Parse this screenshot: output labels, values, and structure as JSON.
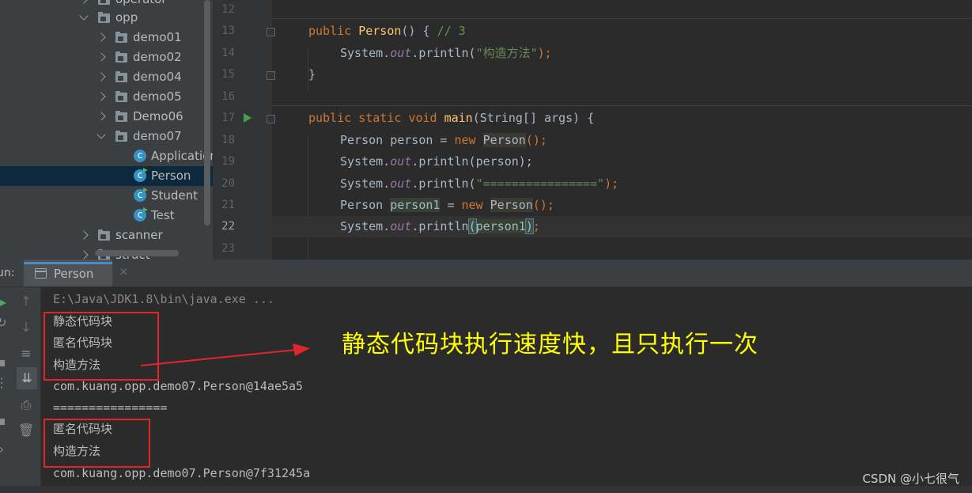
{
  "project_tree": {
    "items": [
      {
        "label": "operator",
        "type": "folder",
        "state": "collapsed"
      },
      {
        "label": "opp",
        "type": "folder",
        "state": "expanded"
      },
      {
        "label": "demo01",
        "type": "folder",
        "state": "collapsed"
      },
      {
        "label": "demo02",
        "type": "folder",
        "state": "collapsed"
      },
      {
        "label": "demo04",
        "type": "folder",
        "state": "collapsed"
      },
      {
        "label": "demo05",
        "type": "folder",
        "state": "collapsed"
      },
      {
        "label": "Demo06",
        "type": "folder",
        "state": "collapsed"
      },
      {
        "label": "demo07",
        "type": "folder",
        "state": "expanded"
      },
      {
        "label": "Application",
        "type": "class"
      },
      {
        "label": "Person",
        "type": "class",
        "selected": true
      },
      {
        "label": "Student",
        "type": "class"
      },
      {
        "label": "Test",
        "type": "class"
      },
      {
        "label": "scanner",
        "type": "folder",
        "state": "collapsed"
      },
      {
        "label": "struct",
        "type": "folder",
        "state": "collapsed"
      }
    ]
  },
  "editor": {
    "line_numbers": [
      "12",
      "13",
      "14",
      "15",
      "16",
      "17",
      "18",
      "19",
      "20",
      "21",
      "22",
      "23"
    ],
    "current_line": "22",
    "lines": {
      "l13": {
        "kw": "public ",
        "fn": "Person",
        "rest": "() { ",
        "comment": "// 3"
      },
      "l14": {
        "a": "System.",
        "it": "out",
        "b": ".println(",
        "str": "\"构造方法\"",
        "c": ");"
      },
      "l15": {
        "a": "}"
      },
      "l17": {
        "kw": "public static void ",
        "fn": "main",
        "rest": "(String[] args) {"
      },
      "l18": {
        "a": "Person person = ",
        "kw": "new ",
        "cls": "Person",
        "b": "();"
      },
      "l19": {
        "a": "System.",
        "it": "out",
        "b": ".println(person);"
      },
      "l20": {
        "a": "System.",
        "it": "out",
        "b": ".println(",
        "str": "\"================\"",
        "c": ");"
      },
      "l21": {
        "a": "Person ",
        "var": "person1",
        "b": " = ",
        "kw": "new ",
        "cls": "Person",
        "c": "();"
      },
      "l22": {
        "a": "System.",
        "it": "out",
        "b": ".println",
        "p1": "(",
        "arg": "person1",
        "p2": ")",
        "c": ";"
      }
    }
  },
  "run_panel": {
    "label": "un:",
    "tab": "Person",
    "close": "×",
    "console": [
      "E:\\Java\\JDK1.8\\bin\\java.exe ...",
      "静态代码块",
      "匿名代码块",
      "构造方法",
      "com.kuang.opp.demo07.Person@14ae5a5",
      "================",
      "匿名代码块",
      "构造方法",
      "com.kuang.opp.demo07.Person@7f31245a"
    ],
    "toolbar_icons": [
      "up-arrow-icon",
      "down-arrow-icon",
      "soft-wrap-icon",
      "scroll-to-end-icon",
      "print-icon",
      "trash-icon"
    ]
  },
  "annotation": "静态代码块执行速度快，且只执行一次",
  "watermark": "CSDN @小七很气",
  "colors": {
    "annotation": "#ffff00",
    "box": "#e0262b",
    "keyword": "#cc7832",
    "function": "#ffc66d"
  }
}
